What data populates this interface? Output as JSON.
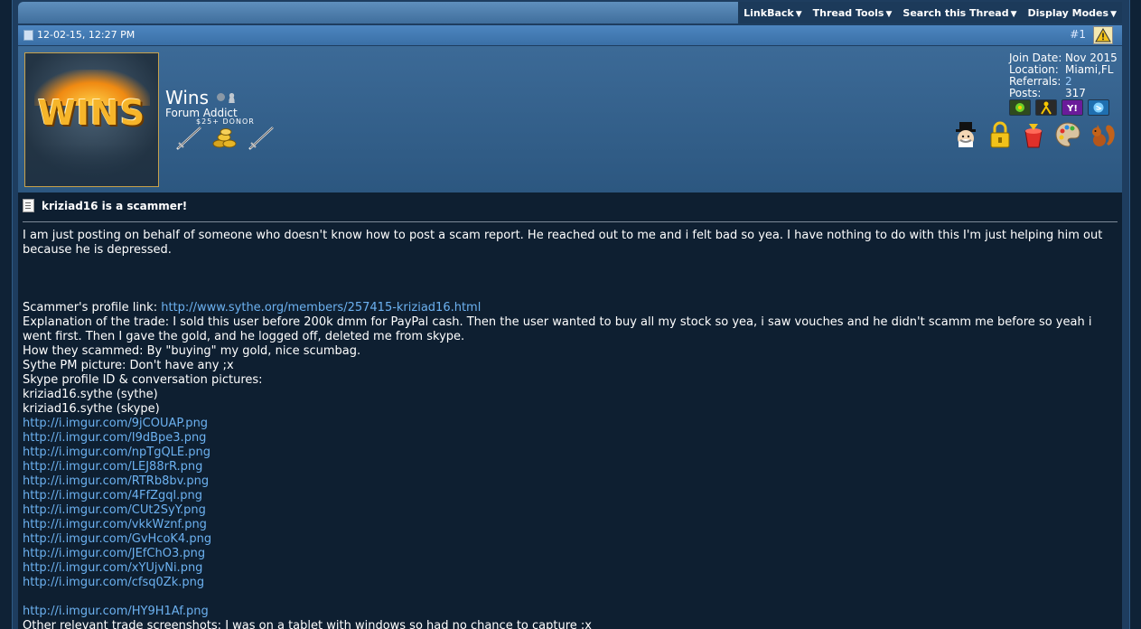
{
  "toolbar": {
    "menus": [
      {
        "label": "LinkBack"
      },
      {
        "label": "Thread Tools"
      },
      {
        "label": "Search this Thread"
      },
      {
        "label": "Display Modes"
      }
    ]
  },
  "post": {
    "date": "12-02-15, 12:27 PM",
    "number": "#1",
    "author": {
      "name": "Wins",
      "title": "Forum Addict",
      "donor_text": "$25+ DONOR",
      "avatar_text": "WINS",
      "stats": [
        {
          "label": "Join Date:",
          "value": "Nov 2015"
        },
        {
          "label": "Location:",
          "value": "Miami,FL"
        },
        {
          "label": "Referrals:",
          "value": "2",
          "link": true
        },
        {
          "label": "Posts:",
          "value": "317"
        }
      ]
    },
    "title": "kriziad16 is a scammer!",
    "intro": "I am just posting on behalf of someone who doesn't know how to post a scam report. He reached out to me and i felt bad so yea. I have nothing to do with this I'm just helping him out because he is depressed.",
    "profile_label": "Scammer's profile link: ",
    "profile_link": "http://www.sythe.org/members/257415-kriziad16.html",
    "explanation": "Explanation of the trade: I sold this user before 200k dmm for PayPal cash. Then the user wanted to buy all my stock so yea, i saw vouches and he didn't scamm me before so yeah i went first. Then I gave the gold, and he logged off, deleted me from skype.",
    "how": "How they scammed: By \"buying\" my gold, nice scumbag.",
    "pm": "Sythe PM picture: Don't have any ;x",
    "skype_label": "Skype profile ID & conversation pictures:",
    "skype_ids": [
      "kriziad16.sythe (sythe)",
      "kriziad16.sythe (skype)"
    ],
    "links": [
      "http://i.imgur.com/9jCOUAP.png",
      "http://i.imgur.com/I9dBpe3.png",
      "http://i.imgur.com/npTgQLE.png",
      "http://i.imgur.com/LEJ88rR.png",
      "http://i.imgur.com/RTRb8bv.png",
      "http://i.imgur.com/4FfZgql.png",
      "http://i.imgur.com/CUt2SyY.png",
      "http://i.imgur.com/vkkWznf.png",
      "http://i.imgur.com/GvHcoK4.png",
      "http://i.imgur.com/JEfChO3.png",
      "http://i.imgur.com/xYUjvNi.png",
      "http://i.imgur.com/cfsq0Zk.png"
    ],
    "last_link": "http://i.imgur.com/HY9H1Af.png",
    "other": "Other relevant trade screenshots: I was on a tablet with windows so had no chance to capture ;x"
  },
  "colors": {
    "link": "#6cb1f0",
    "post_bg": "#0e1f31",
    "header_blue": "#3a6fa6"
  }
}
